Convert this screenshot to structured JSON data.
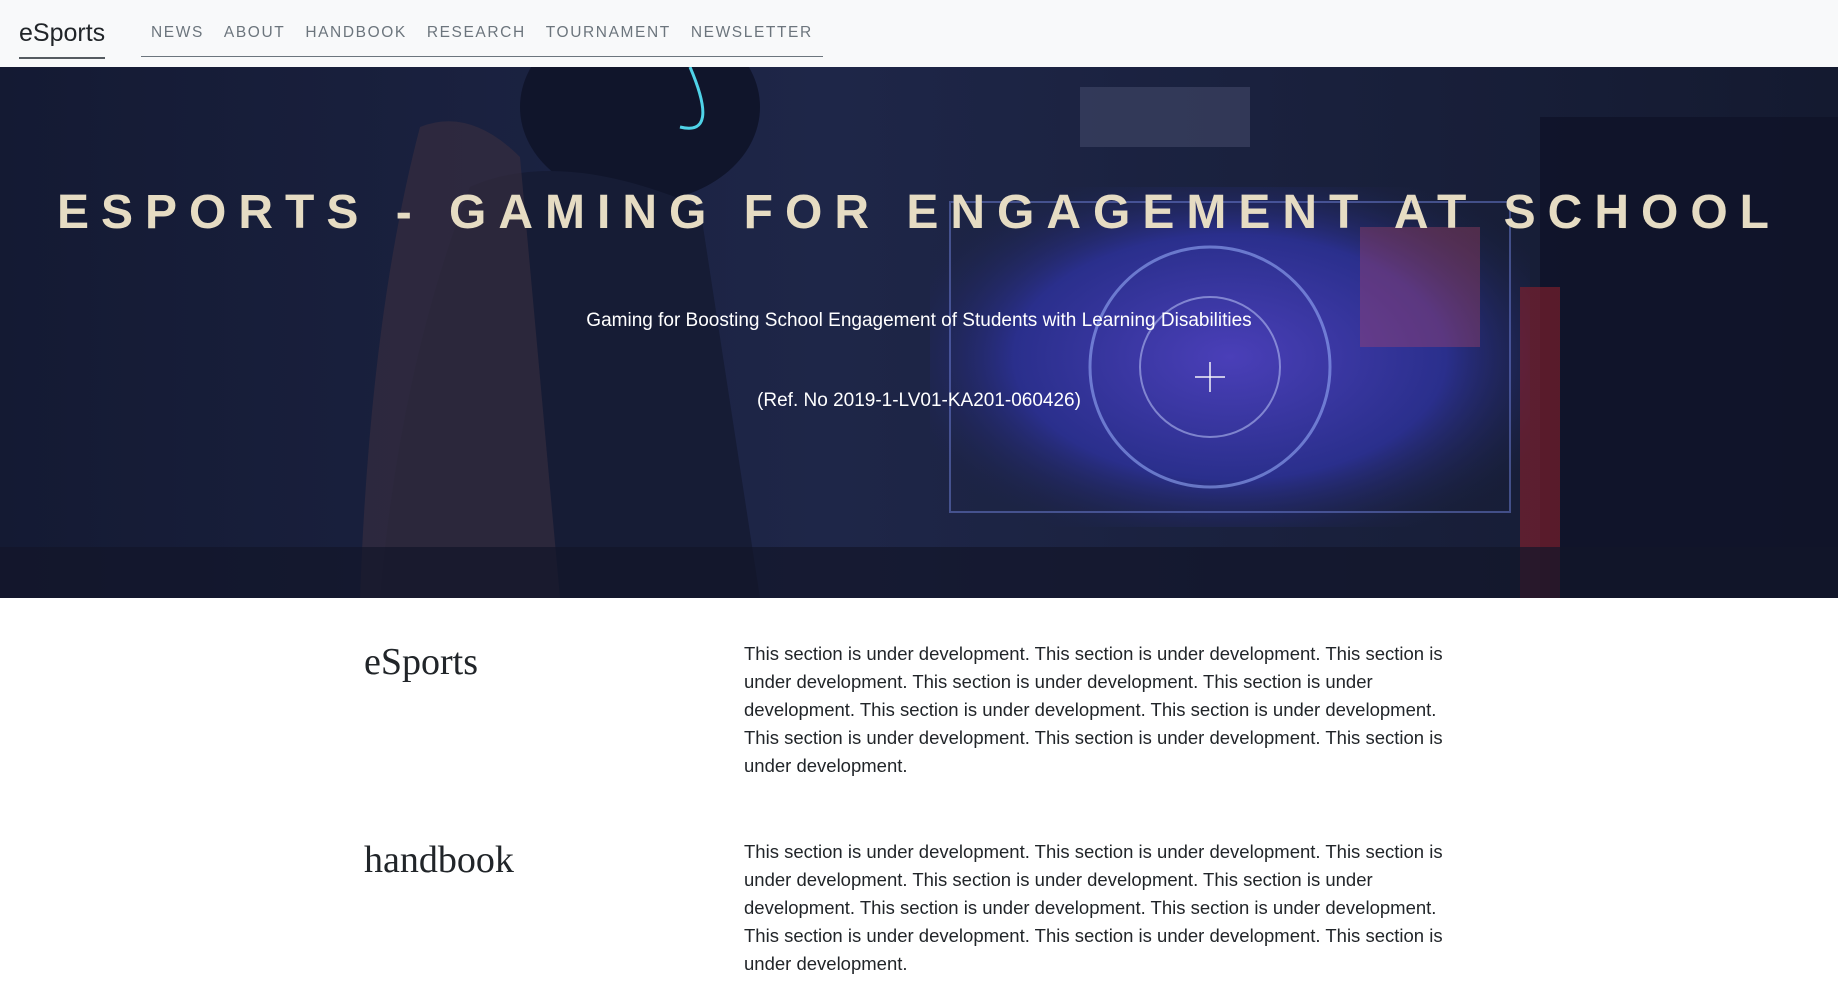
{
  "navbar": {
    "brand": "eSports",
    "links": [
      "NEWS",
      "ABOUT",
      "HANDBOOK",
      "RESEARCH",
      "TOURNAMENT",
      "NEWSLETTER"
    ]
  },
  "hero": {
    "title": "ESPORTS - GAMING FOR ENGAGEMENT AT SCHOOL",
    "subtitle": "Gaming for Boosting School Engagement of Students with Learning Disabilities",
    "ref": "(Ref. No 2019-1-LV01-KA201-060426)"
  },
  "sections": [
    {
      "heading": "eSports",
      "text": "This section is under development. This section is under development. This section is under development. This section is under development. This section is under development. This section is under development. This section is under development. This section is under development. This section is under development. This section is under development."
    },
    {
      "heading": "handbook",
      "text": "This section is under development. This section is under development. This section is under development. This section is under development. This section is under development. This section is under development. This section is under development. This section is under development. This section is under development. This section is under development."
    }
  ],
  "colors": {
    "navbar_bg": "#f8f9fa",
    "hero_bg": "#1b2240",
    "hero_title": "#e6dcc3",
    "nav_link": "#6c757d",
    "text": "#212529"
  }
}
